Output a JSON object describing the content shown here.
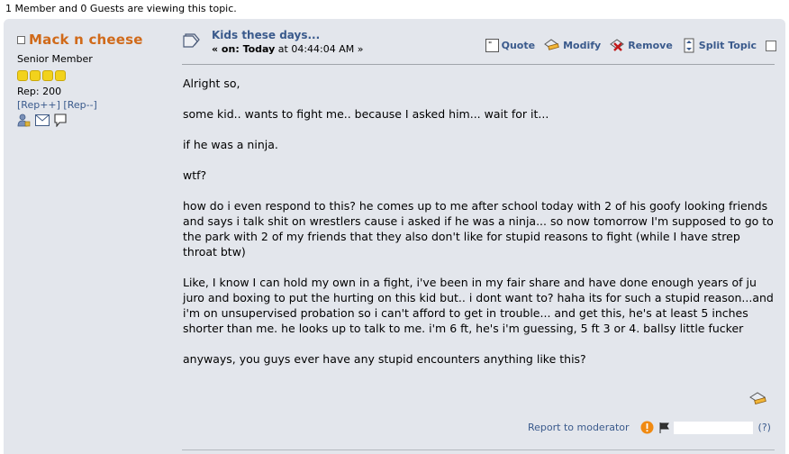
{
  "viewing_text": "1 Member and 0 Guests are viewing this topic.",
  "author": {
    "name": "Mack n cheese",
    "title": "Senior Member",
    "stars": 4,
    "rep": "Rep: 200",
    "rep_plus": "[Rep++]",
    "rep_minus": "[Rep--]"
  },
  "post": {
    "subject": "Kids these days...",
    "date_prefix": "« on: ",
    "date_day": "Today",
    "date_time": " at 04:44:04 AM »",
    "actions": {
      "quote": "Quote",
      "modify": "Modify",
      "remove": "Remove",
      "split": "Split Topic"
    },
    "paragraphs": [
      "Alright so,",
      "some kid.. wants to fight me.. because I asked him... wait for it...",
      "if he was a ninja.",
      "wtf?",
      "how do i even respond to this? he comes up to me after school today with 2 of his goofy looking friends and says i talk shit on wrestlers cause i asked if he was a ninja... so now tomorrow I'm supposed to go to the park with 2 of my friends that they also don't like for stupid reasons to fight (while I have strep throat btw)",
      "Like, I know I can hold my own in a fight, i've been in my fair share and have done enough years of ju juro and boxing to put the hurting on this kid but.. i dont want to? haha its for such a stupid reason...and i'm on unsupervised probation so i can't afford to get in trouble...  and get this, he's at least 5 inches shorter than me. he looks up to talk to me. i'm 6 ft, he's i'm guessing, 5 ft 3 or 4. ballsy little fucker",
      "anyways, you guys ever have any stupid encounters anything like this?"
    ],
    "report": "Report to moderator",
    "help": "(?)"
  },
  "colors": {
    "post_bg": "#e3e6ec",
    "author_name": "#d06a1a",
    "link": "#3a5a8c"
  }
}
